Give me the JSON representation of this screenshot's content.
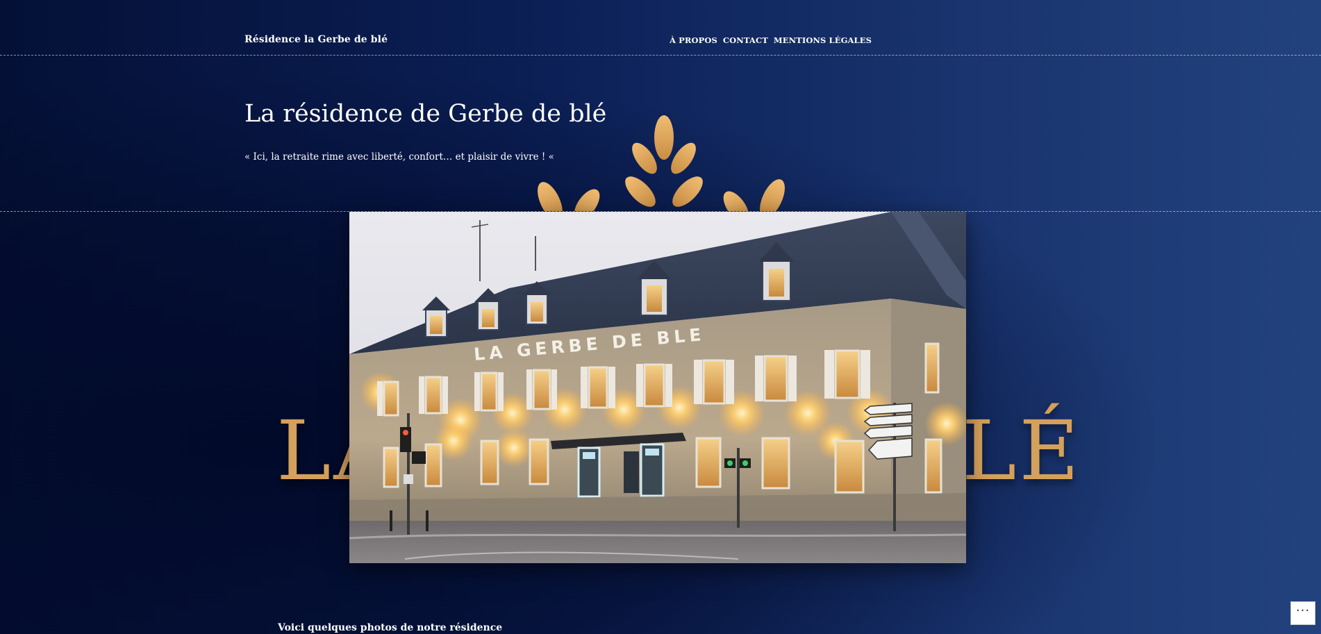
{
  "header": {
    "site_title": "Résidence la Gerbe de blé",
    "nav": [
      {
        "label": "À PROPOS"
      },
      {
        "label": "CONTACT"
      },
      {
        "label": "MENTIONS LÉGALES"
      }
    ]
  },
  "hero": {
    "title": "La résidence de Gerbe de blé",
    "tagline": "« Ici, la retraite rime avec liberté, confort… et plaisir de vivre ! «"
  },
  "background_logo": {
    "text_left": "LA",
    "text_right": "LÉ",
    "color": "#d4a05b"
  },
  "featured_image": {
    "sign_text": "LA GERBE DE BLE"
  },
  "content": {
    "heading": "Voici quelques photos de notre résidence"
  },
  "actions": {
    "label": "···"
  },
  "colors": {
    "background_dark": "#041036",
    "background_light": "#22427e",
    "accent_gold": "#d4a05b"
  }
}
